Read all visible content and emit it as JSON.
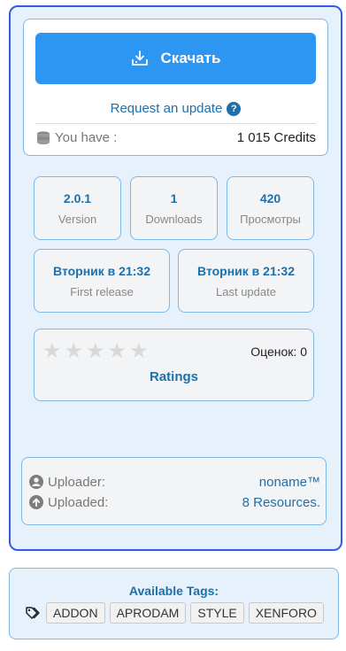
{
  "download": {
    "label": "Скачать"
  },
  "request_update": {
    "label": "Request an update",
    "help": "?"
  },
  "credits": {
    "label": "You have :",
    "value": "1 015 Credits"
  },
  "stats": [
    {
      "value": "2.0.1",
      "label": "Version"
    },
    {
      "value": "1",
      "label": "Downloads"
    },
    {
      "value": "420",
      "label": "Просмотры"
    }
  ],
  "dates": [
    {
      "value": "Вторник в 21:32",
      "label": "First release"
    },
    {
      "value": "Вторник в 21:32",
      "label": "Last update"
    }
  ],
  "ratings": {
    "stars_total": 5,
    "stars_filled": 0,
    "votes_label": "Оценок: 0",
    "link_label": "Ratings"
  },
  "uploader": {
    "uploader_label": "Uploader:",
    "uploader_value": "noname™",
    "uploaded_label": "Uploaded:",
    "uploaded_value": "8 Resources."
  },
  "tags": {
    "title": "Available Tags:",
    "items": [
      "ADDON",
      "APRODAM",
      "STYLE",
      "XENFORO"
    ]
  },
  "colors": {
    "accent": "#2d95f2",
    "link": "#1f6fa8",
    "border": "#7fb8e6",
    "panel": "#e6f1fb",
    "frame": "#2f5de8"
  }
}
